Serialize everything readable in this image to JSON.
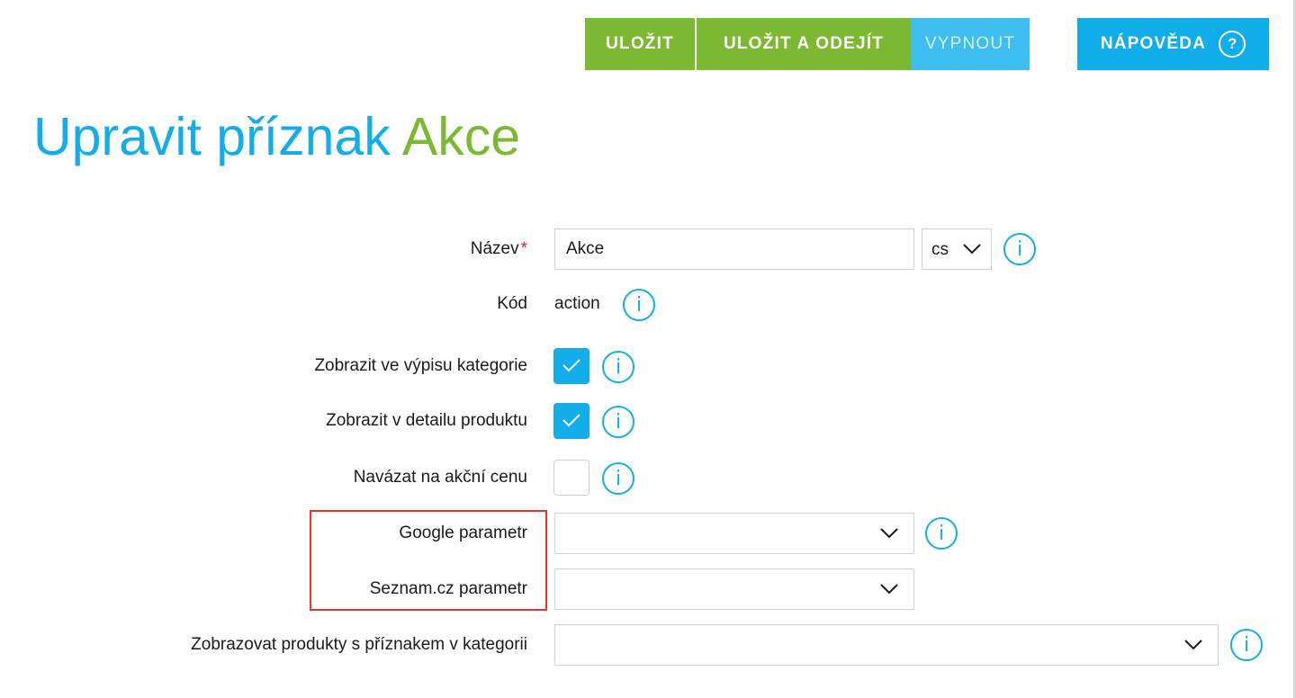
{
  "toolbar": {
    "save_label": "ULOŽIT",
    "save_exit_label": "ULOŽIT A ODEJÍT",
    "disable_label": "VYPNOUT",
    "help_label": "NÁPOVĚDA",
    "help_icon": "?"
  },
  "heading": {
    "main": "Upravit příznak",
    "accent": "Akce"
  },
  "form": {
    "name": {
      "label": "Název",
      "required_mark": "*",
      "value": "Akce",
      "lang": "cs"
    },
    "code": {
      "label": "Kód",
      "value": "action"
    },
    "show_in_category": {
      "label": "Zobrazit ve výpisu kategorie",
      "checked": true
    },
    "show_in_detail": {
      "label": "Zobrazit v detailu produktu",
      "checked": true
    },
    "link_action_price": {
      "label": "Navázat na akční cenu",
      "checked": false
    },
    "google_param": {
      "label": "Google parametr",
      "value": ""
    },
    "seznam_param": {
      "label": "Seznam.cz parametr",
      "value": ""
    },
    "show_products_category": {
      "label": "Zobrazovat produkty s příznakem v kategorii",
      "value": ""
    },
    "info_icon": "i"
  },
  "colors": {
    "green": "#7cb832",
    "blue": "#13aee9",
    "light_blue": "#3ebdf1",
    "highlight_red": "#e8332a"
  }
}
